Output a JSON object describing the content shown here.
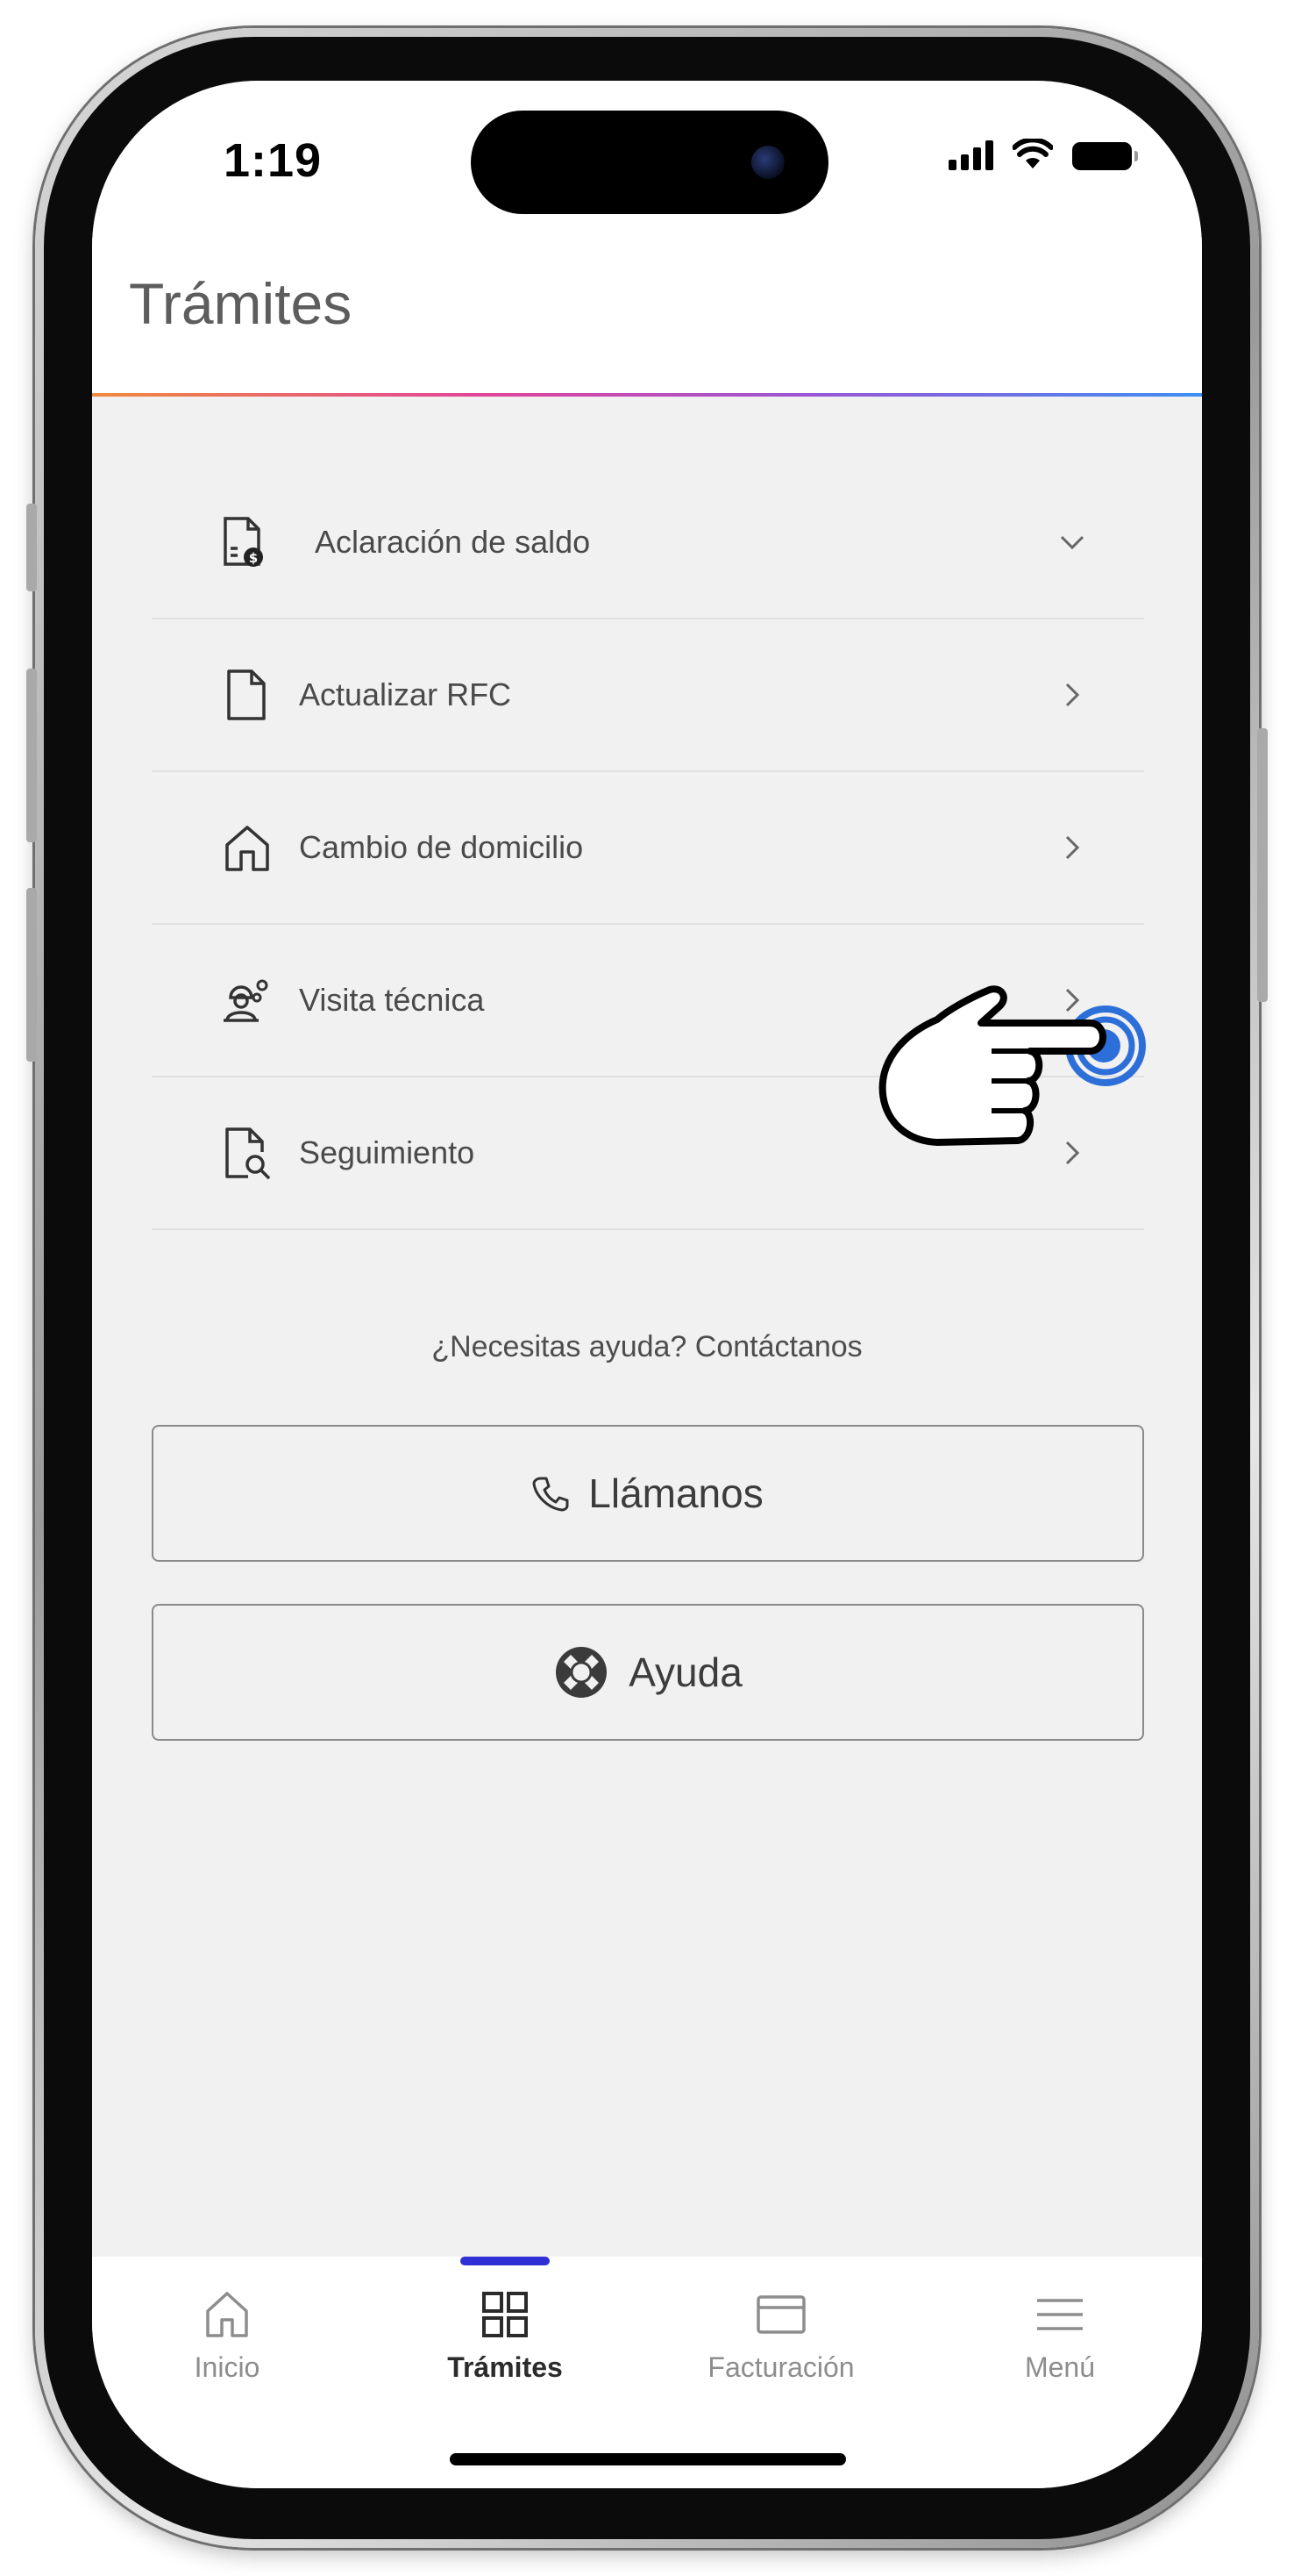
{
  "status_bar": {
    "time": "1:19"
  },
  "header": {
    "title": "Trámites"
  },
  "list": {
    "items": [
      {
        "label": "Aclaración de saldo",
        "icon": "document-dollar-icon",
        "chevron": "chevron-down-icon"
      },
      {
        "label": "Actualizar RFC",
        "icon": "document-icon",
        "chevron": "chevron-right-icon"
      },
      {
        "label": "Cambio de domicilio",
        "icon": "home-icon",
        "chevron": "chevron-right-icon"
      },
      {
        "label": "Visita técnica",
        "icon": "technician-icon",
        "chevron": "chevron-right-icon"
      },
      {
        "label": "Seguimiento",
        "icon": "document-search-icon",
        "chevron": "chevron-right-icon"
      }
    ]
  },
  "help": {
    "text": "¿Necesitas ayuda? Contáctanos",
    "call_label": "Llámanos",
    "help_label": "Ayuda"
  },
  "tabbar": {
    "items": [
      {
        "label": "Inicio",
        "icon": "home-icon"
      },
      {
        "label": "Trámites",
        "icon": "grid-icon",
        "active": true
      },
      {
        "label": "Facturación",
        "icon": "card-icon"
      },
      {
        "label": "Menú",
        "icon": "menu-icon"
      }
    ]
  },
  "colors": {
    "accent": "#2f2fd6",
    "background": "#f1f1f1",
    "text": "#4a4a4a"
  }
}
